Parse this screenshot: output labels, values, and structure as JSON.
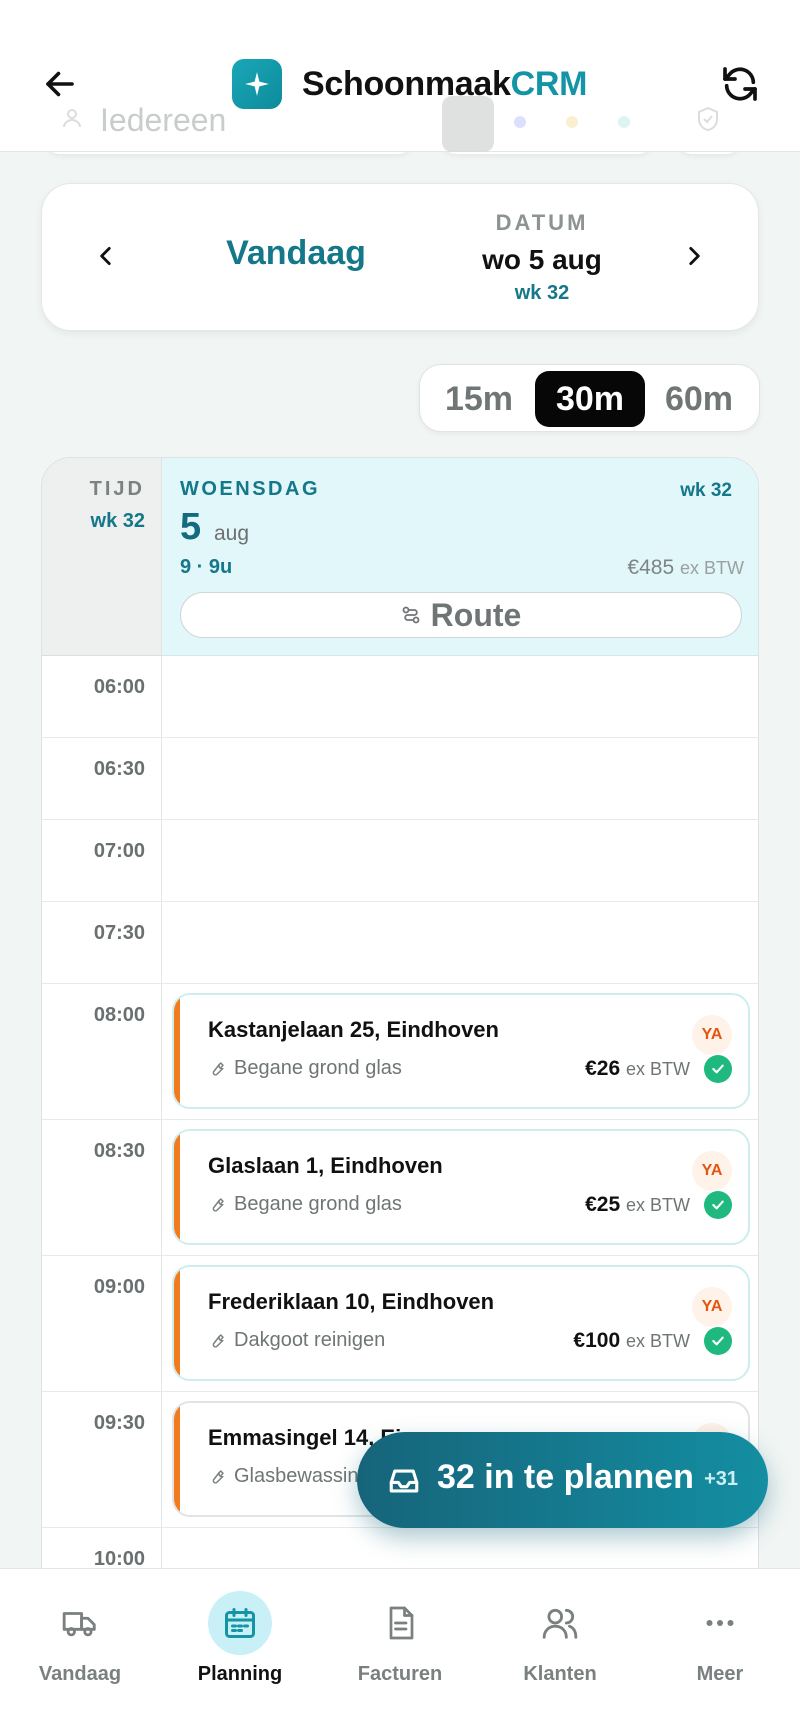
{
  "header": {
    "brand_main": "Schoonmaak",
    "brand_accent": "CRM",
    "back_icon": "arrow-left-icon",
    "refresh_icon": "refresh-icon",
    "filter_placeholder": "Iedereen"
  },
  "date_nav": {
    "today_label": "Vandaag",
    "date_label": "DATUM",
    "date_value": "wo 5 aug",
    "week": "wk 32"
  },
  "zoom": {
    "options": [
      "15m",
      "30m",
      "60m"
    ],
    "selected": "30m"
  },
  "calendar": {
    "time_header": "TIJD",
    "time_week": "wk 32",
    "day_name": "WOENSDAG",
    "day_number": "5",
    "day_month": "aug",
    "day_week": "wk 32",
    "day_summary": "9 · 9u",
    "day_total": "€485",
    "day_total_suffix": "ex BTW",
    "route_label": "Route",
    "times": [
      "06:00",
      "06:30",
      "07:00",
      "07:30",
      "08:00",
      "08:30",
      "09:00",
      "09:30",
      "10:00"
    ],
    "appointments": [
      {
        "address": "Kastanjelaan 25, Eindhoven",
        "service": "Begane grond glas",
        "price": "€26",
        "price_suffix": "ex BTW",
        "badge": "YA",
        "status": "done"
      },
      {
        "address": "Glaslaan 1, Eindhoven",
        "service": "Begane grond glas",
        "price": "€25",
        "price_suffix": "ex BTW",
        "badge": "YA",
        "status": "done"
      },
      {
        "address": "Frederiklaan 10, Eindhoven",
        "service": "Dakgoot reinigen",
        "price": "€100",
        "price_suffix": "ex BTW",
        "badge": "YA",
        "status": "done"
      },
      {
        "address": "Emmasingel 14, Ei",
        "service": "Glasbewassin",
        "price": "",
        "price_suffix": "",
        "badge": "YA",
        "status": ""
      }
    ]
  },
  "fab": {
    "label": "32 in te plannen",
    "extra": "+31"
  },
  "bottom_nav": {
    "items": [
      {
        "label": "Vandaag",
        "icon": "truck-icon"
      },
      {
        "label": "Planning",
        "icon": "calendar-icon"
      },
      {
        "label": "Facturen",
        "icon": "document-icon"
      },
      {
        "label": "Klanten",
        "icon": "users-icon"
      },
      {
        "label": "Meer",
        "icon": "more-icon"
      }
    ],
    "active": "Planning"
  },
  "colors": {
    "brand": "#1495a6",
    "accent_orange": "#f37b1f",
    "success": "#1fb980",
    "day_header_bg": "#e2f7fa"
  }
}
